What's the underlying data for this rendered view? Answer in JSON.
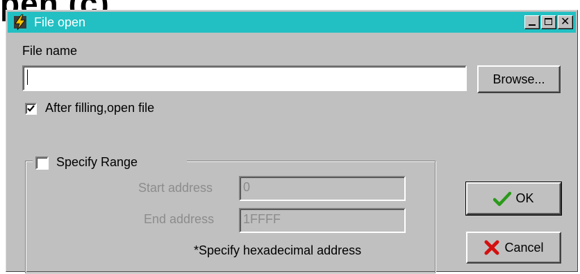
{
  "page": {
    "heading": "pen (c)"
  },
  "window": {
    "title": "File open",
    "icon": "lightning-app-icon",
    "controls": [
      "minimize-icon",
      "maximize-icon",
      "close-icon"
    ]
  },
  "file_name": {
    "label": "File name",
    "value": "",
    "browse_label": "Browse..."
  },
  "open_after": {
    "label": "After filling,open file",
    "checked": true
  },
  "range": {
    "label": "Specify Range",
    "checked": false,
    "start_label": "Start address",
    "start_value": "0",
    "end_label": "End address",
    "end_value": "1FFFF",
    "note": "*Specify hexadecimal address"
  },
  "buttons": {
    "ok_label": "OK",
    "ok_icon": "checkmark-icon",
    "ok_icon_color": "#2a9a1a",
    "cancel_label": "Cancel",
    "cancel_icon": "x-icon",
    "cancel_icon_color": "#d41010"
  },
  "colors": {
    "titlebar": "#22c0c3",
    "dialog_face": "#c0c0c0"
  }
}
